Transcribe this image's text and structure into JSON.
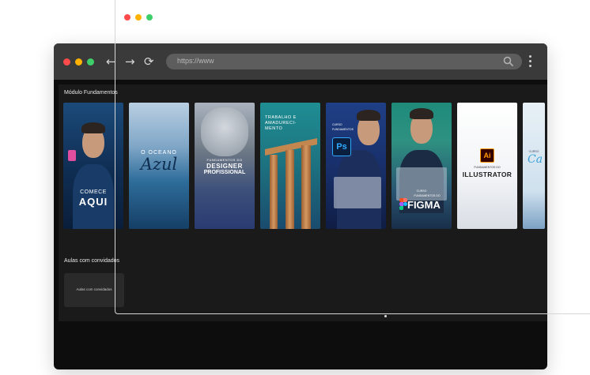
{
  "colors": {
    "dot_red": "#ff4b4b",
    "dot_yellow": "#ffb300",
    "dot_green": "#3fcf6a",
    "browser_bg": "#0d0d0d",
    "section_bg": "#1a1a1a"
  },
  "browser": {
    "url": "https://www",
    "back_icon": "back-arrow-icon",
    "forward_icon": "forward-arrow-icon",
    "reload_icon": "reload-icon",
    "search_icon": "search-icon",
    "menu_icon": "kebab-menu-icon"
  },
  "section1": {
    "title": "Módulo Fundamentos",
    "cards": [
      {
        "line1": "COMECE",
        "line2": "AQUI"
      },
      {
        "line1": "O OCEANO",
        "line2": "Azul"
      },
      {
        "line1": "FUNDAMENTOS DO",
        "line2": "DESIGNER",
        "line3": "PROFISSIONAL"
      },
      {
        "line1": "TRABALHO E",
        "line2": "AMADURECI-",
        "line3": "MENTO"
      },
      {
        "line1": "CURSO",
        "line2": "FUNDAMENTOS",
        "badge": "Ps"
      },
      {
        "line1": "CURSO",
        "line2": "FUNDAMENTOS DO",
        "line3": "FIGMA"
      },
      {
        "line1": "FUNDAMENTOS DO",
        "line2": "ILLUSTRATOR",
        "badge": "Ai"
      },
      {
        "line1": "CURSO",
        "line2": "Ca"
      }
    ]
  },
  "section2": {
    "title": "Aulas com convidados",
    "card_label": "Aulas com convidados"
  }
}
